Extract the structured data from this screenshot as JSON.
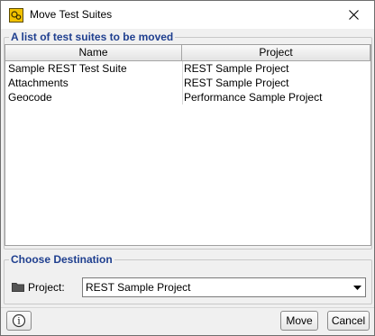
{
  "window": {
    "title": "Move Test Suites",
    "icon": "soapui-app-icon",
    "close_icon": "close-icon"
  },
  "suites_group": {
    "title": "A list of test suites to be moved",
    "columns": [
      "Name",
      "Project"
    ],
    "rows": [
      {
        "name": "Sample REST Test Suite",
        "project": "REST Sample Project"
      },
      {
        "name": "Attachments",
        "project": "REST Sample Project"
      },
      {
        "name": "Geocode",
        "project": "Performance Sample Project"
      }
    ]
  },
  "destination_group": {
    "title": "Choose Destination",
    "project_label": "Project:",
    "project_value": "REST Sample Project",
    "folder_icon": "folder-icon",
    "dropdown_icon": "dropdown-arrow-icon"
  },
  "buttons": {
    "info_label": "i",
    "move_label": "Move",
    "cancel_label": "Cancel"
  },
  "colors": {
    "group_title": "#1f3f8f",
    "window_bg": "#f0f0f0",
    "table_bg": "#ffffff"
  }
}
